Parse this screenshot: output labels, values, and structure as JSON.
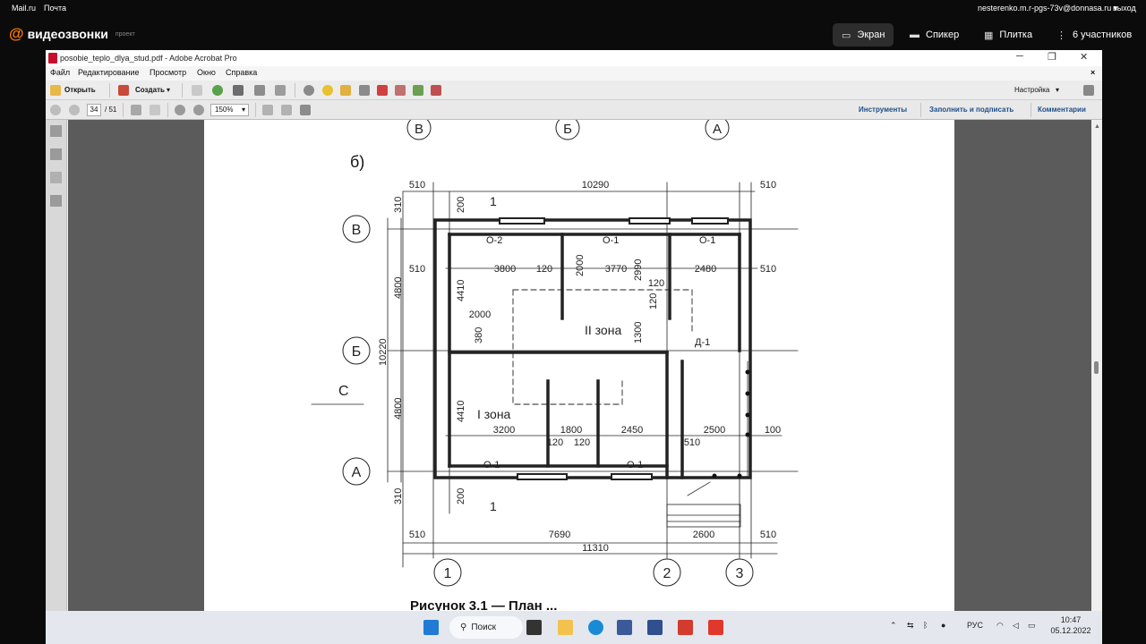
{
  "top_links": {
    "mail": "Mail.ru",
    "post": "Почта",
    "user": "nesterenko.m.r-pgs-73v@donnasa.ru ▾",
    "exit": "выход"
  },
  "video": {
    "brand": "видеозвонки",
    "project": "проект",
    "buttons": [
      {
        "label": "Экран",
        "icon": "screen-icon",
        "active": true
      },
      {
        "label": "Спикер",
        "icon": "speaker-icon",
        "active": false
      },
      {
        "label": "Плитка",
        "icon": "tile-icon",
        "active": false
      },
      {
        "label": "6 участников",
        "icon": "participants-icon",
        "active": false
      }
    ]
  },
  "acrobat": {
    "title": "posobie_teplo_dlya_stud.pdf - Adobe Acrobat Pro",
    "menu": [
      "Файл",
      "Редактирование",
      "Просмотр",
      "Окно",
      "Справка"
    ],
    "toolbar": {
      "open": "Открыть",
      "create": "Создать",
      "customize": "Настройка"
    },
    "nav": {
      "page": "34",
      "pages": "/ 51",
      "zoom": "150%"
    },
    "right_tabs": [
      "Инструменты",
      "Заполнить и подписать",
      "Комментарии"
    ]
  },
  "drawing": {
    "label": "б)",
    "axes_letters": [
      "В",
      "Б",
      "А"
    ],
    "axes_numbers": [
      "1",
      "2",
      "3"
    ],
    "dims_top": [
      "510",
      "10290",
      "510"
    ],
    "dims_bottom": [
      "510",
      "7690",
      "2600",
      "510",
      "11310"
    ],
    "dims_left": [
      "310",
      "4800",
      "10220",
      "4800",
      "310"
    ],
    "dims_inner": [
      "200",
      "510",
      "3800",
      "120",
      "2000",
      "3770",
      "2990",
      "2480",
      "510",
      "4410",
      "2000",
      "380",
      "1300",
      "120",
      "120",
      "4410",
      "3200",
      "120",
      "1800",
      "120",
      "2450",
      "510",
      "2500",
      "100",
      "200"
    ],
    "windows": [
      "О-2",
      "О-1",
      "О-1",
      "О-1",
      "О-1"
    ],
    "zones": [
      "II зона",
      "I зона"
    ],
    "door": "Д-1",
    "section": "1",
    "north": "С",
    "caption": "Рисунок 3.1 — План ..."
  },
  "taskbar": {
    "search": "Поиск",
    "lang": "РУС",
    "time": "10:47",
    "date": "05.12.2022"
  }
}
